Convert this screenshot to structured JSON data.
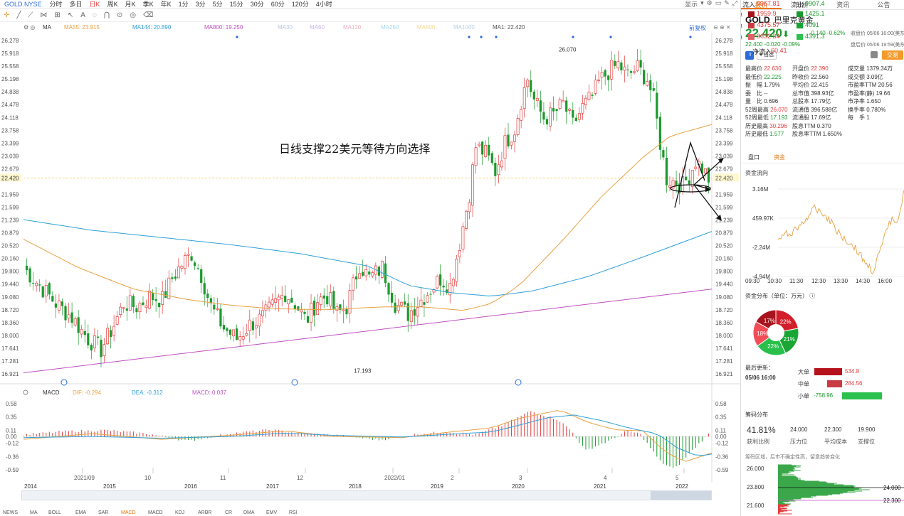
{
  "toolbar": {
    "symbol": "GOLD.NYSE",
    "periods": [
      "分时",
      "多日",
      "日K",
      "周K",
      "月K",
      "季K",
      "年K",
      "1分",
      "3分",
      "5分",
      "15分",
      "30分",
      "60分",
      "120分",
      "4小时"
    ],
    "active_period": "日K",
    "right_items": [
      "显示",
      "▾"
    ]
  },
  "ma_legend": {
    "ma": "MA",
    "ma55": "MA55: 23.915",
    "ma144": "MA144: 20.890",
    "ma800": "MA800: 19.250",
    "others": [
      "MA30",
      "MA60",
      "MA120",
      "MA250",
      "MA600",
      "MA1000"
    ],
    "ma1": "MA1: 22.420",
    "fq": "前复权"
  },
  "annotation": "日线支撑22美元等待方向选择",
  "price_axis": [
    "26.278",
    "25.918",
    "25.558",
    "25.198",
    "24.838",
    "24.478",
    "24.118",
    "23.758",
    "23.399",
    "23.039",
    "22.679",
    "22.420",
    "21.959",
    "21.599",
    "21.239",
    "20.879",
    "20.520",
    "20.160",
    "19.800",
    "19.440",
    "19.080",
    "18.720",
    "18.360",
    "18.000",
    "17.641",
    "17.281",
    "16.921"
  ],
  "high_label": "26.070",
  "low_label": "17.193",
  "current_price_line": "22.420",
  "macd_legend": {
    "name": "MACD",
    "dif": "DIF: -0.294",
    "dea": "DEA: -0.312",
    "macd": "MACD: 0.037"
  },
  "macd_axis": [
    "0.58",
    "0.35",
    "0.11",
    "0.00",
    "-0.12",
    "-0.36",
    "-0.59"
  ],
  "month_axis": [
    "2021/09",
    "10",
    "11",
    "12",
    "2022/01",
    "2",
    "3",
    "4",
    "5"
  ],
  "year_axis": [
    "2014",
    "2015",
    "2016",
    "2017",
    "2018",
    "2019",
    "2020",
    "2021",
    "2022"
  ],
  "indicator_tabs": [
    "NEWS",
    "MA",
    "BOLL",
    "EMA",
    "SAR",
    "MACD",
    "MACD",
    "KDJ",
    "ARBR",
    "CR",
    "DMA",
    "EMV",
    "RSI"
  ],
  "right_tabs": [
    "报价",
    "分析",
    "资讯",
    "公告"
  ],
  "quote": {
    "symbol": "GOLD",
    "name": "巴里克黄金",
    "price": "22.420",
    "arrow": "⬇",
    "change": "-0.140",
    "change_pct": "-0.62%",
    "close_time": "收盘价 05/06 16:00(美东)",
    "post_price": "22.400",
    "post_change": "-0.020",
    "post_pct": "-0.09%",
    "post_time": "盘后价 05/06 19:59(美东)",
    "tag": "自选",
    "trade": "交易"
  },
  "stats": [
    [
      "最高价 22.630",
      "开盘价 22.390",
      "成交量 1379.34万"
    ],
    [
      "最低价 22.225",
      "昨收价 22.560",
      "成交额 3.09亿"
    ],
    [
      "振　幅 1.79%",
      "平均价 22.415",
      "市盈率TTM 20.56"
    ],
    [
      "委　比 --",
      "总市值 398.93亿",
      "市盈率(静) 19.66"
    ],
    [
      "量　比 0.696",
      "总股本 17.79亿",
      "市净率 1.650"
    ],
    [
      "52周最高 26.070",
      "流通值 396.588亿",
      "换手率 0.780%"
    ],
    [
      "52周最低 17.193",
      "流通股 17.69亿",
      "每　手 1"
    ],
    [
      "历史最高 30.296",
      "股息TTM 0.370",
      ""
    ],
    [
      "历史最低 1.577",
      "股息率TTM 1.650%",
      ""
    ]
  ],
  "sub_tabs": [
    "盘口",
    "资金"
  ],
  "fund_flow": {
    "title": "资金流向",
    "y_labels": [
      "3.16M",
      "459.97K",
      "-2.24M",
      "-4.94M"
    ],
    "x_labels": [
      "09:30",
      "10:30",
      "11:30",
      "12:30",
      "13:30",
      "14:30",
      "16:00"
    ]
  },
  "fund_dist": {
    "title": "资金分布（单位：万元）",
    "in_label": "流入",
    "in_total": "9967.81",
    "out_label": "流出",
    "out_total": "9907.4",
    "rows": [
      {
        "label": "大单",
        "in": "1959.9",
        "out": "1425.1"
      },
      {
        "label": "中单",
        "in": "4375.57",
        "out": "4091"
      },
      {
        "label": "小单",
        "in": "3632.34",
        "out": "4391.3"
      }
    ],
    "pie": [
      {
        "label": "22%",
        "value": 22,
        "color": "#d21f2b"
      },
      {
        "label": "21%",
        "value": 21,
        "color": "#1aa634"
      },
      {
        "label": "22%",
        "value": 22,
        "color": "#28c04a"
      },
      {
        "label": "18%",
        "value": 18,
        "color": "#f04d57"
      },
      {
        "label": "17%",
        "value": 17,
        "color": "#a8141d"
      }
    ],
    "net_label": "净流入",
    "net_value": "60.41",
    "updated_label": "最后更新：",
    "updated_time": "05/06 16:00",
    "net_rows": [
      {
        "label": "大单",
        "value": "534.8",
        "sign": 1
      },
      {
        "label": "中单",
        "value": "284.56",
        "sign": 1
      },
      {
        "label": "小单",
        "value": "-758.96",
        "sign": -1
      }
    ]
  },
  "chips": {
    "title": "筹码分布",
    "profit": "41.81%",
    "profit_label": "获利比例",
    "pressure": "24.000",
    "pressure_label": "压力位",
    "avg": "22.300",
    "avg_label": "平均成本",
    "support": "19.900",
    "support_label": "支撑位",
    "note": "筹码区域，后市不确定性高，留意趋势变化",
    "axis": [
      "26.000",
      "23.800",
      "21.600"
    ],
    "mark1": "24.000",
    "mark2": "22.300"
  },
  "colors": {
    "up": "#e23d3d",
    "down": "#1a9a2c",
    "ma55": "#e8a040",
    "ma144": "#2fa0d8",
    "ma800": "#c050c0",
    "accent": "#e8740c"
  }
}
